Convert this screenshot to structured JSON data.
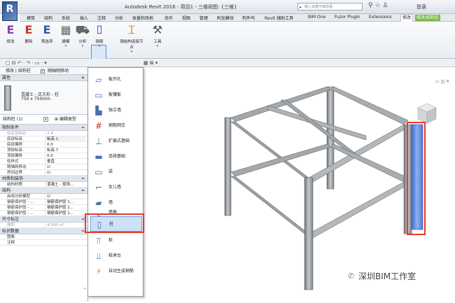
{
  "app": {
    "logo": "R",
    "title": "Autodesk Revit 2016 -    项目1 - 三维视图: {三维}",
    "search_placeholder": "键入关键字或短语",
    "login": "登录"
  },
  "tabs": [
    {
      "label": "建筑"
    },
    {
      "label": "结构"
    },
    {
      "label": "系统"
    },
    {
      "label": "插入"
    },
    {
      "label": "注释"
    },
    {
      "label": "分析"
    },
    {
      "label": "体量和场地"
    },
    {
      "label": "协作"
    },
    {
      "label": "视图"
    },
    {
      "label": "管理"
    },
    {
      "label": "附加模块"
    },
    {
      "label": "构件坞"
    },
    {
      "label": "Revit 辅助工具"
    },
    {
      "label": "BIM One"
    },
    {
      "label": "Fuzor Plugin"
    },
    {
      "label": "Extensions"
    },
    {
      "label": "修改"
    },
    {
      "label": "修改|结构柱"
    }
  ],
  "ribbon": {
    "buttons": [
      {
        "label": "修改"
      },
      {
        "label": "删除"
      },
      {
        "label": "筛选项"
      },
      {
        "label": "建模"
      },
      {
        "label": "分析"
      },
      {
        "label": "钢筋"
      },
      {
        "label": "钢结构连接节点"
      },
      {
        "label": "工具"
      }
    ]
  },
  "context_bar": {
    "label": "修改 | 结构柱",
    "check_label": "随轴网移动"
  },
  "properties": {
    "header": "属性",
    "type_name": "混凝土 - 正方形 - 柱",
    "type_size": "750 x 750mm",
    "instance_label": "结构柱 (1)",
    "edit_type": "编辑类型",
    "groups": [
      {
        "name": "限制条件",
        "rows": [
          {
            "k": "柱定位标记",
            "v": "2-4",
            "dim": true
          },
          {
            "k": "底部标高",
            "v": "标高 1"
          },
          {
            "k": "底部偏移",
            "v": "0.0"
          },
          {
            "k": "顶部标高",
            "v": "标高 7"
          },
          {
            "k": "顶部偏移",
            "v": "0.0"
          },
          {
            "k": "柱样式",
            "v": "垂直"
          },
          {
            "k": "随轴网移动",
            "v": "☑"
          },
          {
            "k": "房间边界",
            "v": "☑"
          }
        ]
      },
      {
        "name": "材质和装饰",
        "rows": [
          {
            "k": "结构材质",
            "v": "混凝土 - 现场..."
          }
        ]
      },
      {
        "name": "结构",
        "rows": [
          {
            "k": "启用分析模型",
            "v": "☑"
          },
          {
            "k": "钢筋保护层 - ...",
            "v": "钢筋保护层 1..."
          },
          {
            "k": "钢筋保护层 - ...",
            "v": "钢筋保护层 1..."
          },
          {
            "k": "钢筋保护层 - ...",
            "v": "钢筋保护层 1..."
          }
        ]
      },
      {
        "name": "尺寸标注",
        "rows": [
          {
            "k": "体积",
            "v": "4.500 m³",
            "dim": true
          }
        ]
      },
      {
        "name": "标识数据",
        "rows": [
          {
            "k": "图像",
            "v": ""
          },
          {
            "k": "注释",
            "v": ""
          }
        ]
      }
    ]
  },
  "menu": {
    "items": [
      {
        "label": "板开孔",
        "icon": "opening-icon"
      },
      {
        "label": "板镶板",
        "icon": "slab-panel-icon"
      },
      {
        "label": "独立墙",
        "icon": "wall-icon"
      },
      {
        "label": "钢筋网交",
        "icon": "mesh-icon"
      },
      {
        "label": "扩展式基础",
        "icon": "footing-icon"
      },
      {
        "label": "连续基础",
        "icon": "strip-footing-icon"
      },
      {
        "label": "梁",
        "icon": "beam-icon"
      },
      {
        "label": "女儿墙",
        "icon": "parapet-icon"
      },
      {
        "label": "墙",
        "icon": "wall-block-icon"
      },
      {
        "label": "墙角",
        "icon": "wall-corner-icon"
      },
      {
        "label": "柱",
        "icon": "column-icon"
      },
      {
        "label": "桩",
        "icon": "pile-icon"
      },
      {
        "label": "桩承台",
        "icon": "pile-cap-icon"
      },
      {
        "label": "自动生成钢筋",
        "icon": "auto-rebar-icon"
      }
    ]
  },
  "watermark": "深圳BIM工作室",
  "colors": {
    "accent": "#5b8fdc",
    "highlight": "#e53a2a",
    "context_tab": "#7db54d"
  }
}
